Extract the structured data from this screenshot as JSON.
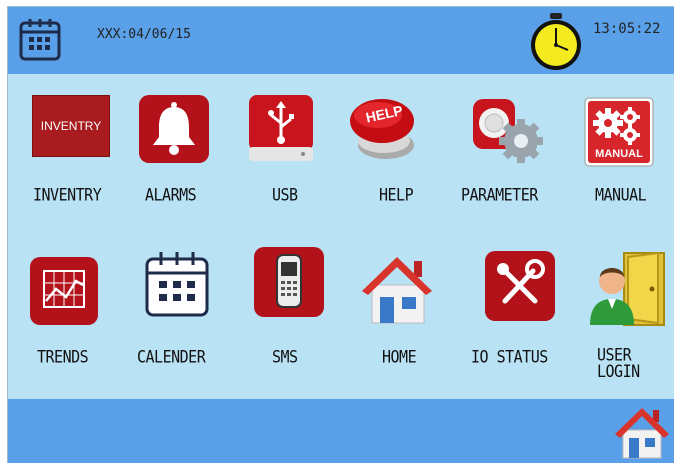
{
  "header": {
    "date": "XXX:04/06/15",
    "time": "13:05:22",
    "calendar_icon": "calendar-icon",
    "clock_icon": "clock-icon"
  },
  "menu": [
    {
      "label": "INVENTRY",
      "icon": "inventory-icon",
      "icon_text": "INVENTRY"
    },
    {
      "label": "ALARMS",
      "icon": "alarm-bell-icon"
    },
    {
      "label": "USB",
      "icon": "usb-icon"
    },
    {
      "label": "HELP",
      "icon": "help-button-icon",
      "icon_text": "HELP"
    },
    {
      "label": "PARAMETER",
      "icon": "parameter-gear-icon"
    },
    {
      "label": "MANUAL",
      "icon": "manual-gears-icon",
      "icon_text": "MANUAL"
    },
    {
      "label": "TRENDS",
      "icon": "trend-chart-icon"
    },
    {
      "label": "CALENDER",
      "icon": "calendar-icon"
    },
    {
      "label": "SMS",
      "icon": "mobile-phone-icon"
    },
    {
      "label": "HOME",
      "icon": "home-icon"
    },
    {
      "label": "IO STATUS",
      "icon": "tools-icon"
    },
    {
      "label": "USER LOGIN",
      "label_line1": "USER",
      "label_line2": "LOGIN",
      "icon": "user-login-door-icon"
    }
  ],
  "footer": {
    "home_icon": "home-icon"
  },
  "colors": {
    "bar": "#5aa0e9",
    "background": "#b9e2f5",
    "tile_red": "#b3121b"
  }
}
